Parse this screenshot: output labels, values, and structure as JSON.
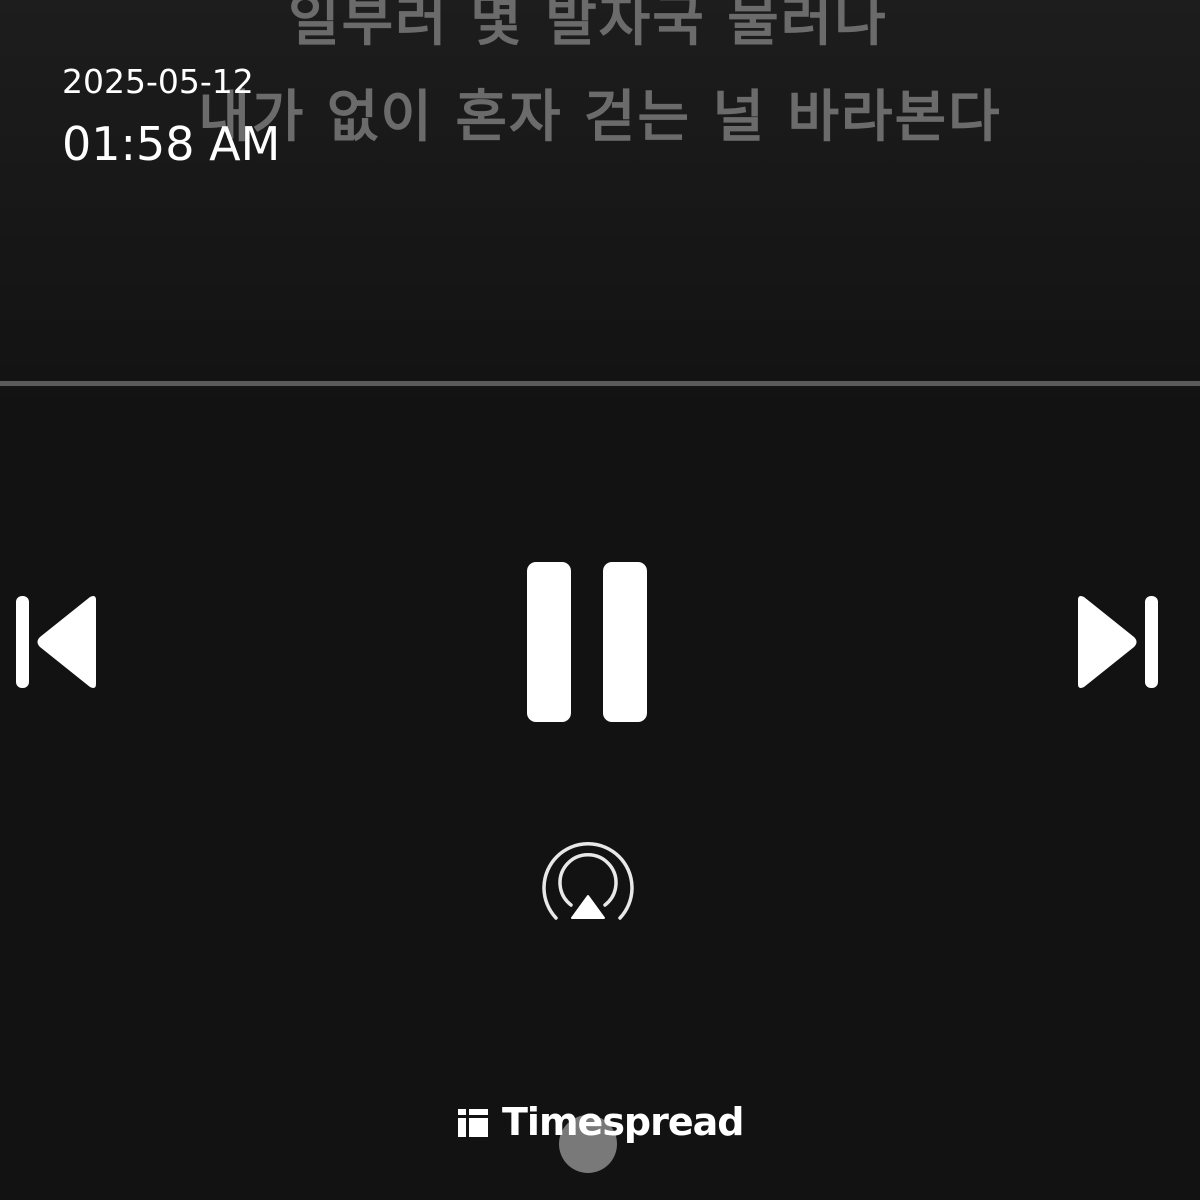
{
  "lyrics": {
    "lines": [
      "일부러 몇 발자국 물러나",
      "내가 없이 혼자 걷는 널 바라본다"
    ]
  },
  "status": {
    "date": "2025-05-12",
    "time": "01:58 AM"
  },
  "player": {
    "progress_fraction": 1.0,
    "controls": {
      "previous_icon": "skip-previous-icon",
      "pause_icon": "pause-icon",
      "next_icon": "skip-next-icon",
      "airplay_icon": "airplay-icon"
    }
  },
  "watermark": {
    "text": "Timespread"
  },
  "colors": {
    "background": "#121212",
    "lyric_dim": "#6b6b6b",
    "track": "#3e3e3e",
    "icon": "#ffffff"
  }
}
